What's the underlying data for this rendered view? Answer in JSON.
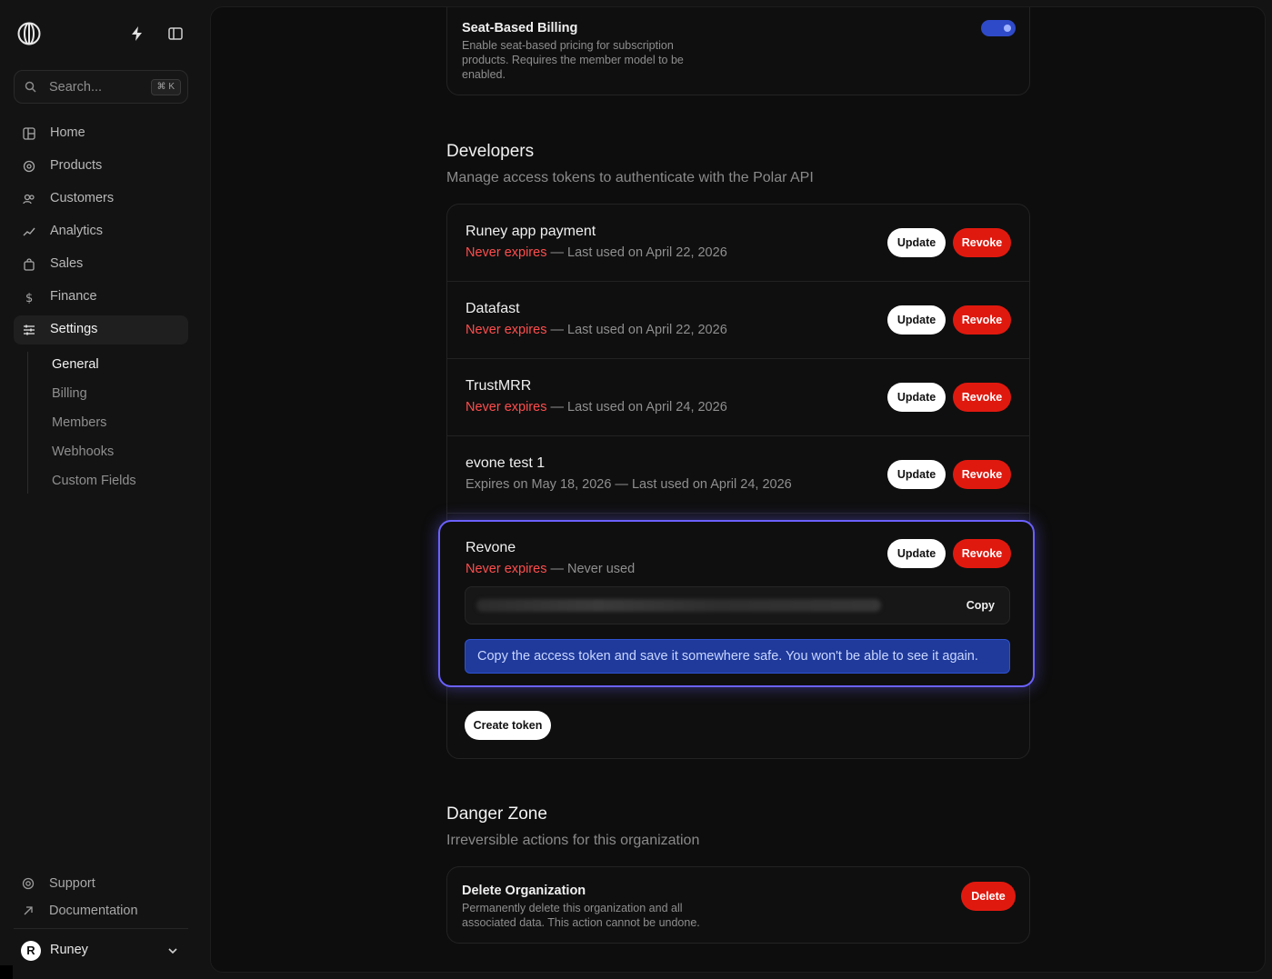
{
  "sidebar": {
    "search": {
      "placeholder": "Search...",
      "shortcut": "⌘ K"
    },
    "nav": [
      {
        "label": "Home",
        "icon": "home-icon"
      },
      {
        "label": "Products",
        "icon": "products-icon"
      },
      {
        "label": "Customers",
        "icon": "customers-icon"
      },
      {
        "label": "Analytics",
        "icon": "analytics-icon"
      },
      {
        "label": "Sales",
        "icon": "sales-icon"
      },
      {
        "label": "Finance",
        "icon": "finance-icon"
      },
      {
        "label": "Settings",
        "icon": "settings-icon",
        "active": true
      }
    ],
    "settings_sub": [
      {
        "label": "General",
        "active": true
      },
      {
        "label": "Billing"
      },
      {
        "label": "Members"
      },
      {
        "label": "Webhooks"
      },
      {
        "label": "Custom Fields"
      }
    ],
    "footer": {
      "support": "Support",
      "documentation": "Documentation",
      "user": "Runey",
      "user_initial": "R"
    }
  },
  "seat_billing": {
    "title": "Seat-Based Billing",
    "description": "Enable seat-based pricing for subscription products. Requires the member model to be enabled.",
    "enabled": true
  },
  "developers": {
    "title": "Developers",
    "subtitle": "Manage access tokens to authenticate with the Polar API",
    "update_label": "Update",
    "revoke_label": "Revoke",
    "tokens": [
      {
        "name": "Runey app payment",
        "expiry": "Never expires",
        "usage": " — Last used on April 22, 2026"
      },
      {
        "name": "Datafast",
        "expiry": "Never expires",
        "usage": " — Last used on April 22, 2026"
      },
      {
        "name": "TrustMRR",
        "expiry": "Never expires",
        "usage": " — Last used on April 24, 2026"
      },
      {
        "name": "evone test 1",
        "expiry_plain": "Expires on May 18, 2026",
        "usage": " — Last used on April 24, 2026"
      },
      {
        "name": "Revone",
        "expiry": "Never expires",
        "usage": " — Never used"
      }
    ],
    "copy_label": "Copy",
    "notice": "Copy the access token and save it somewhere safe. You won't be able to see it again.",
    "create_label": "Create token"
  },
  "danger_zone": {
    "title": "Danger Zone",
    "subtitle": "Irreversible actions for this organization",
    "delete_title": "Delete Organization",
    "delete_description": "Permanently delete this organization and all associated data. This action cannot be undone.",
    "delete_label": "Delete"
  },
  "colors": {
    "accent": "#6b61ff",
    "danger": "#e0190f",
    "warn_text": "#ff4d4d",
    "notice_bg": "#1f3a9b"
  }
}
